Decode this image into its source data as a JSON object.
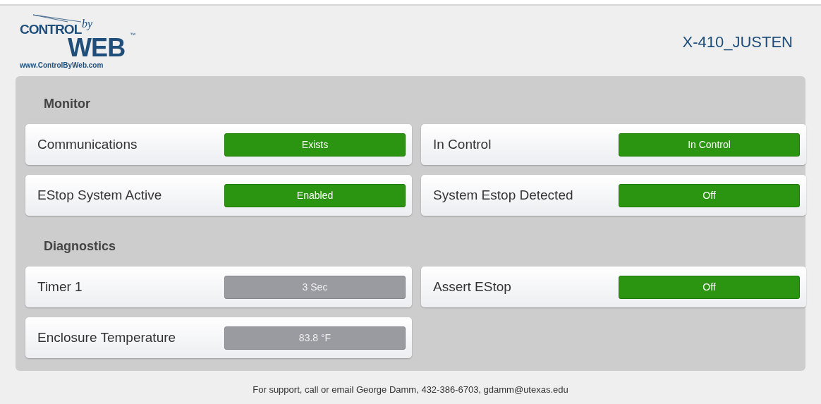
{
  "logo": {
    "word_1": "CONTROL",
    "word_2": "by",
    "word_3": "WEB",
    "trademark": "™",
    "url": "www.ControlByWeb.com"
  },
  "device_name": "X-410_JUSTEN",
  "sections": [
    {
      "title": "Monitor",
      "items": [
        {
          "label": "Communications",
          "value": "Exists",
          "kind": "indicator"
        },
        {
          "label": "In Control",
          "value": "In Control",
          "kind": "indicator"
        },
        {
          "label": "EStop System Active",
          "value": "Enabled",
          "kind": "indicator"
        },
        {
          "label": "System Estop Detected",
          "value": "Off",
          "kind": "indicator"
        }
      ]
    },
    {
      "title": "Diagnostics",
      "items": [
        {
          "label": "Timer 1",
          "value": "3 Sec",
          "kind": "reading"
        },
        {
          "label": "Assert EStop",
          "value": "Off",
          "kind": "indicator"
        },
        {
          "label": "Enclosure Temperature",
          "value": "83.8 °F",
          "kind": "reading"
        }
      ]
    }
  ],
  "footer": "For support, call or email George Damm, 432-386-6703, gdamm@utexas.edu"
}
